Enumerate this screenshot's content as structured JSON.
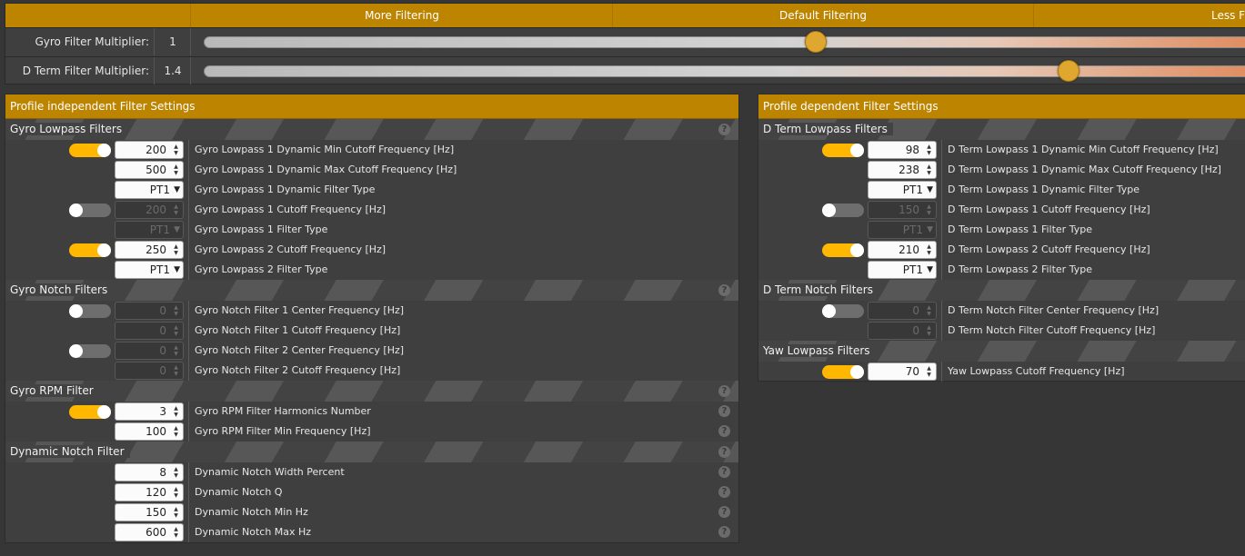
{
  "slider_header": {
    "more": "More Filtering",
    "default": "Default Filtering",
    "less": "Less Fi"
  },
  "sliders": [
    {
      "label": "Gyro Filter Multiplier:",
      "value": "1",
      "level": 0.58
    },
    {
      "label": "D Term Filter Multiplier:",
      "value": "1.4",
      "level": 0.82
    }
  ],
  "left_panel": {
    "title": "Profile independent Filter Settings",
    "groups": [
      {
        "title": "Gyro Lowpass Filters",
        "help": true,
        "rows": [
          {
            "toggle": "on",
            "type": "number",
            "value": "200",
            "label": "Gyro Lowpass 1 Dynamic Min Cutoff Frequency [Hz]"
          },
          {
            "type": "number",
            "value": "500",
            "label": "Gyro Lowpass 1 Dynamic Max Cutoff Frequency [Hz]"
          },
          {
            "type": "select",
            "value": "PT1",
            "label": "Gyro Lowpass 1 Dynamic Filter Type"
          },
          {
            "toggle": "off",
            "type": "number",
            "value": "200",
            "disabled": true,
            "label": "Gyro Lowpass 1 Cutoff Frequency [Hz]"
          },
          {
            "type": "select",
            "value": "PT1",
            "disabled": true,
            "label": "Gyro Lowpass 1 Filter Type"
          },
          {
            "toggle": "on",
            "type": "number",
            "value": "250",
            "label": "Gyro Lowpass 2 Cutoff Frequency [Hz]"
          },
          {
            "type": "select",
            "value": "PT1",
            "label": "Gyro Lowpass 2 Filter Type"
          }
        ]
      },
      {
        "title": "Gyro Notch Filters",
        "help": true,
        "rows": [
          {
            "toggle": "off",
            "type": "number",
            "value": "0",
            "disabled": true,
            "label": "Gyro Notch Filter 1 Center Frequency [Hz]"
          },
          {
            "type": "number",
            "value": "0",
            "disabled": true,
            "label": "Gyro Notch Filter 1 Cutoff Frequency [Hz]"
          },
          {
            "toggle": "off",
            "type": "number",
            "value": "0",
            "disabled": true,
            "label": "Gyro Notch Filter 2 Center Frequency [Hz]"
          },
          {
            "type": "number",
            "value": "0",
            "disabled": true,
            "label": "Gyro Notch Filter 2 Cutoff Frequency [Hz]"
          }
        ]
      },
      {
        "title": "Gyro RPM Filter",
        "help": true,
        "rows": [
          {
            "toggle": "on",
            "type": "number",
            "value": "3",
            "label": "Gyro RPM Filter Harmonics Number",
            "help": true
          },
          {
            "type": "number",
            "value": "100",
            "label": "Gyro RPM Filter Min Frequency [Hz]",
            "help": true
          }
        ]
      },
      {
        "title": "Dynamic Notch Filter",
        "help": true,
        "rows": [
          {
            "type": "number",
            "value": "8",
            "label": "Dynamic Notch Width Percent",
            "help": true
          },
          {
            "type": "number",
            "value": "120",
            "label": "Dynamic Notch Q",
            "help": true
          },
          {
            "type": "number",
            "value": "150",
            "label": "Dynamic Notch Min Hz",
            "help": true
          },
          {
            "type": "number",
            "value": "600",
            "label": "Dynamic Notch Max Hz",
            "help": true
          }
        ]
      }
    ]
  },
  "right_panel": {
    "title": "Profile dependent Filter Settings",
    "groups": [
      {
        "title": "D Term Lowpass Filters",
        "rows": [
          {
            "toggle": "on",
            "type": "number",
            "value": "98",
            "label": "D Term Lowpass 1 Dynamic Min Cutoff Frequency [Hz]"
          },
          {
            "type": "number",
            "value": "238",
            "label": "D Term Lowpass 1 Dynamic Max Cutoff Frequency [Hz]"
          },
          {
            "type": "select",
            "value": "PT1",
            "label": "D Term Lowpass 1 Dynamic Filter Type"
          },
          {
            "toggle": "off",
            "type": "number",
            "value": "150",
            "disabled": true,
            "label": "D Term Lowpass 1 Cutoff Frequency [Hz]"
          },
          {
            "type": "select",
            "value": "PT1",
            "disabled": true,
            "label": "D Term Lowpass 1 Filter Type"
          },
          {
            "toggle": "on",
            "type": "number",
            "value": "210",
            "label": "D Term Lowpass 2 Cutoff Frequency [Hz]"
          },
          {
            "type": "select",
            "value": "PT1",
            "label": "D Term Lowpass 2 Filter Type"
          }
        ]
      },
      {
        "title": "D Term Notch Filters",
        "rows": [
          {
            "toggle": "off",
            "type": "number",
            "value": "0",
            "disabled": true,
            "label": "D Term Notch Filter Center Frequency [Hz]"
          },
          {
            "type": "number",
            "value": "0",
            "disabled": true,
            "label": "D Term Notch Filter Cutoff Frequency [Hz]"
          }
        ]
      },
      {
        "title": "Yaw Lowpass Filters",
        "rows": [
          {
            "toggle": "on",
            "type": "number",
            "value": "70",
            "label": "Yaw Lowpass Cutoff Frequency [Hz]"
          }
        ]
      }
    ]
  },
  "colors": {
    "accent": "#bd8400",
    "toggle_on": "#ffb700",
    "background": "#363636"
  }
}
